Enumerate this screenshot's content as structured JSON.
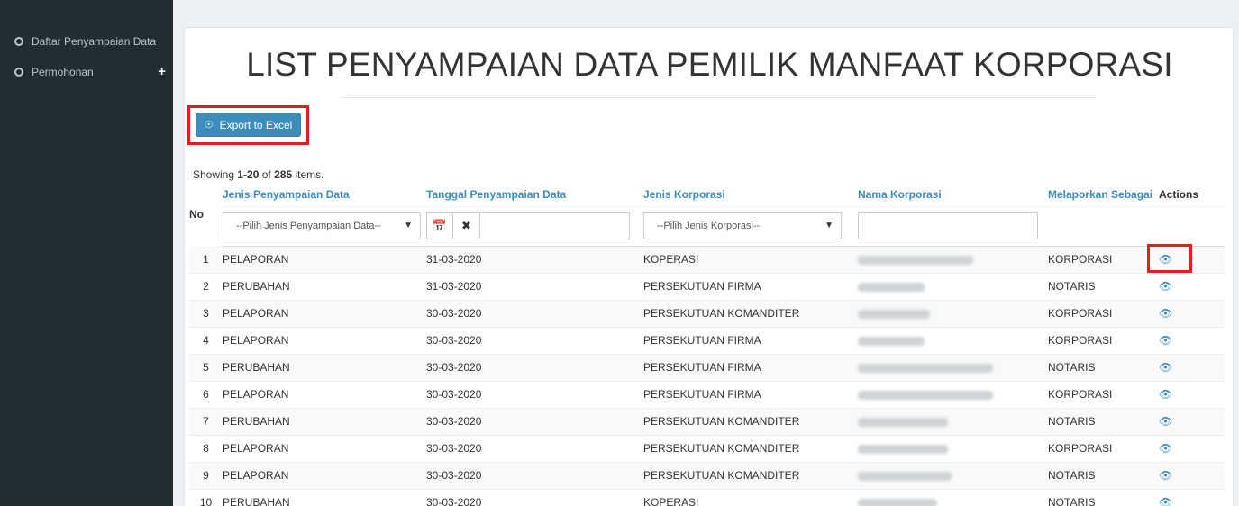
{
  "sidebar": {
    "items": [
      {
        "label": "Daftar Penyampaian Data"
      },
      {
        "label": "Permohonan",
        "expand": "+"
      }
    ]
  },
  "main": {
    "title": "LIST PENYAMPAIAN DATA PEMILIK MANFAAT KORPORASI",
    "export_label": "Export to Excel",
    "summary": {
      "prefix": "Showing ",
      "range": "1-20",
      "middle": " of ",
      "total": "285",
      "suffix": " items."
    }
  },
  "table": {
    "headers": {
      "no": "No",
      "jenis_penyampaian": "Jenis Penyampaian Data",
      "tanggal": "Tanggal Penyampaian Data",
      "jenis_korporasi": "Jenis Korporasi",
      "nama_korporasi": "Nama Korporasi",
      "melaporkan": "Melaporkan Sebagai",
      "actions": "Actions"
    },
    "filters": {
      "jenis_penyampaian": "--Pilih Jenis Penyampaian Data--",
      "jenis_korporasi": "--Pilih Jenis Korporasi--"
    },
    "rows": [
      {
        "no": "1",
        "jenis": "PELAPORAN",
        "tanggal": "31-03-2020",
        "korporasi": "KOPERASI",
        "sebagai": "KORPORASI"
      },
      {
        "no": "2",
        "jenis": "PERUBAHAN",
        "tanggal": "31-03-2020",
        "korporasi": "PERSEKUTUAN FIRMA",
        "sebagai": "NOTARIS"
      },
      {
        "no": "3",
        "jenis": "PELAPORAN",
        "tanggal": "30-03-2020",
        "korporasi": "PERSEKUTUAN KOMANDITER",
        "sebagai": "KORPORASI"
      },
      {
        "no": "4",
        "jenis": "PELAPORAN",
        "tanggal": "30-03-2020",
        "korporasi": "PERSEKUTUAN FIRMA",
        "sebagai": "KORPORASI"
      },
      {
        "no": "5",
        "jenis": "PERUBAHAN",
        "tanggal": "30-03-2020",
        "korporasi": "PERSEKUTUAN FIRMA",
        "sebagai": "NOTARIS"
      },
      {
        "no": "6",
        "jenis": "PELAPORAN",
        "tanggal": "30-03-2020",
        "korporasi": "PERSEKUTUAN FIRMA",
        "sebagai": "KORPORASI"
      },
      {
        "no": "7",
        "jenis": "PERUBAHAN",
        "tanggal": "30-03-2020",
        "korporasi": "PERSEKUTUAN KOMANDITER",
        "sebagai": "NOTARIS"
      },
      {
        "no": "8",
        "jenis": "PELAPORAN",
        "tanggal": "30-03-2020",
        "korporasi": "PERSEKUTUAN KOMANDITER",
        "sebagai": "KORPORASI"
      },
      {
        "no": "9",
        "jenis": "PELAPORAN",
        "tanggal": "30-03-2020",
        "korporasi": "PERSEKUTUAN KOMANDITER",
        "sebagai": "NOTARIS"
      },
      {
        "no": "10",
        "jenis": "PERUBAHAN",
        "tanggal": "30-03-2020",
        "korporasi": "KOPERASI",
        "sebagai": "NOTARIS"
      }
    ]
  },
  "icons": {
    "sidebar_item": "circle-icon",
    "export": "plus-circle-icon",
    "calendar": "calendar-icon",
    "clear": "close-icon",
    "dropdown": "caret-down-icon",
    "view": "eye-icon"
  },
  "colors": {
    "sidebar_bg": "#222d32",
    "accent": "#3c8dbc",
    "highlight": "#e31e1e"
  }
}
